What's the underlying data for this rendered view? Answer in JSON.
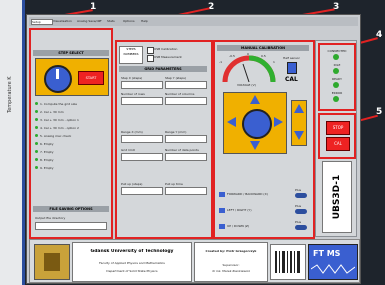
{
  "callouts": [
    "1",
    "2",
    "3",
    "4",
    "5"
  ],
  "tabs": [
    "Setup",
    "Visualisation",
    "Analog Save/diff",
    "Stats",
    "Options",
    "Help"
  ],
  "panel1": {
    "title": "STEP SELECT",
    "start_label": "START",
    "steps": [
      "1. Compute the grid size",
      "2. Cal + 30 mm",
      "3. Cal + 30 mm - option 1",
      "4. Cal + 30 mm - option 2",
      "5. Analog mac check",
      "6. Empty",
      "7. Empty",
      "8. Empty",
      "9. Empty"
    ],
    "file_title": "FILE SAVING OPTIONS",
    "file_label": "Output file directory"
  },
  "panel2": {
    "steps_label": "STEPS NUMBERS",
    "usb1": "USB Calibration",
    "usb2": "USB Measurement",
    "param_title": "GRID PARAMETERS",
    "fields": [
      "Step X (steps)",
      "Step Y (steps)",
      "Number of rows",
      "Number of columns",
      "Range X (mm)",
      "Range Y (mm)",
      "Grid limit",
      "Number of data points",
      "Pull up (steps)",
      "Pull up time"
    ]
  },
  "panel3": {
    "title": "MANUAL CALIBRATION",
    "gauge_ticks": [
      "-1",
      "-0.5",
      "0",
      "0.5",
      "1"
    ],
    "gauge_unit": "VOLTAGE (V)",
    "cal_label": "CAL",
    "halfsensor_label": "Half sensor",
    "controls": [
      "FORWARD / BACKWARD (X)",
      "LEFT / RIGHT (Y)",
      "UP / DOWN (Z)"
    ],
    "plus_label": "Plus"
  },
  "panel4": {
    "status": [
      "CONNECTED",
      "IDLE",
      "READY",
      "ERROR"
    ],
    "stop_label": "STOP",
    "calibrate_label": "CAL",
    "brand": "UBS3D-1"
  },
  "footer": {
    "uni_title": "Gdansk University of Technology",
    "uni_sub1": "Faculty of Applied Physics and Mathematics",
    "uni_sub2": "Department of Solid State Physics",
    "created_by": "Created by: Piotr Grzegorczyk",
    "supervisor": "Supervisor:",
    "supervisor_name": "dr inz. Marek Zienkiewicz",
    "brand": "FT MS"
  },
  "left_axis_label": "Temperature K"
}
